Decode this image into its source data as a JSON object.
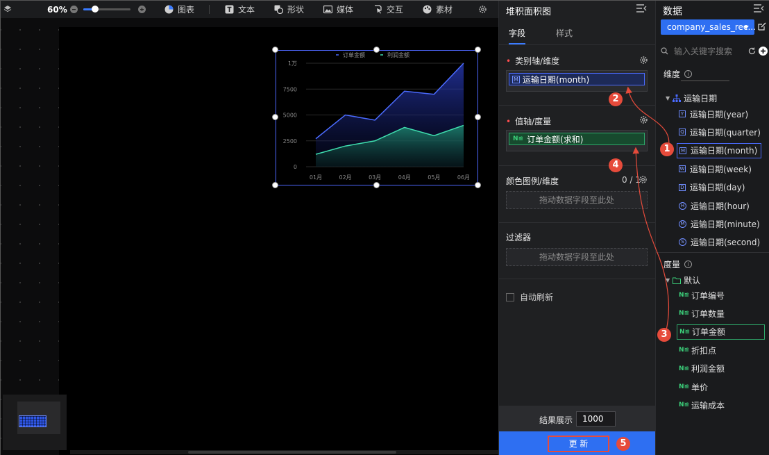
{
  "toolbar": {
    "zoom": "60%",
    "zoom_level": 0.25,
    "items": [
      {
        "label": "图表",
        "icon": "pie-chart-icon"
      },
      {
        "label": "文本",
        "icon": "text-icon"
      },
      {
        "label": "形状",
        "icon": "shape-icon"
      },
      {
        "label": "媒体",
        "icon": "image-icon"
      },
      {
        "label": "交互",
        "icon": "interaction-icon"
      },
      {
        "label": "素材",
        "icon": "palette-icon"
      }
    ]
  },
  "chart_data": {
    "type": "area",
    "stacked": true,
    "categories": [
      "01月",
      "02月",
      "03月",
      "04月",
      "05月",
      "06月"
    ],
    "series": [
      {
        "name": "订单金额",
        "values": [
          2700,
          5000,
          4500,
          7300,
          7000,
          10000
        ],
        "color": "#4b6bff"
      },
      {
        "name": "利润金额",
        "values": [
          1200,
          2000,
          2500,
          3800,
          3000,
          4000
        ],
        "color": "#3fe0b0"
      }
    ],
    "yticks": [
      "0",
      "2500",
      "5000",
      "7500",
      "1万"
    ],
    "ylim": [
      0,
      10000
    ],
    "legend_position": "top-center",
    "grid": true
  },
  "props": {
    "title": "堆积面积图",
    "tabs": [
      "字段",
      "样式"
    ],
    "category_axis_label": "类别轴/维度",
    "category_field": "运输日期(month)",
    "value_axis_label": "值轴/度量",
    "value_field": "订单金额(求和)",
    "color_legend_label": "颜色图例/维度",
    "color_legend_count": "0 / 1",
    "drop_placeholder": "拖动数据字段至此处",
    "filter_label": "过滤器",
    "auto_refresh_label": "自动刷新",
    "result_label": "结果展示",
    "result_value": "1000",
    "update_label": "更 新"
  },
  "data_panel": {
    "title": "数据",
    "dataset": "company_sales_rec...",
    "search_placeholder": "输入关键字搜索",
    "dimensions_title": "维度",
    "date_group": "运输日期",
    "date_fields": [
      {
        "label": "运输日期(year)",
        "badge": "Y"
      },
      {
        "label": "运输日期(quarter)",
        "badge": "Q"
      },
      {
        "label": "运输日期(month)",
        "badge": "M"
      },
      {
        "label": "运输日期(week)",
        "badge": "W"
      },
      {
        "label": "运输日期(day)",
        "badge": "D"
      },
      {
        "label": "运输日期(hour)",
        "badge": "H"
      },
      {
        "label": "运输日期(minute)",
        "badge": "M"
      },
      {
        "label": "运输日期(second)",
        "badge": "S"
      }
    ],
    "measures_title": "度量",
    "measure_folder": "默认",
    "measures": [
      "订单编号",
      "订单数量",
      "订单金额",
      "折扣点",
      "利润金额",
      "单价",
      "运输成本"
    ],
    "number_badge": "N≌"
  },
  "annotations": [
    "1",
    "2",
    "3",
    "4",
    "5"
  ],
  "colors": {
    "accent": "#2e6ff2",
    "marker": "#e64b3b",
    "dimension": "#4b6bff",
    "measure": "#2fa86a"
  }
}
